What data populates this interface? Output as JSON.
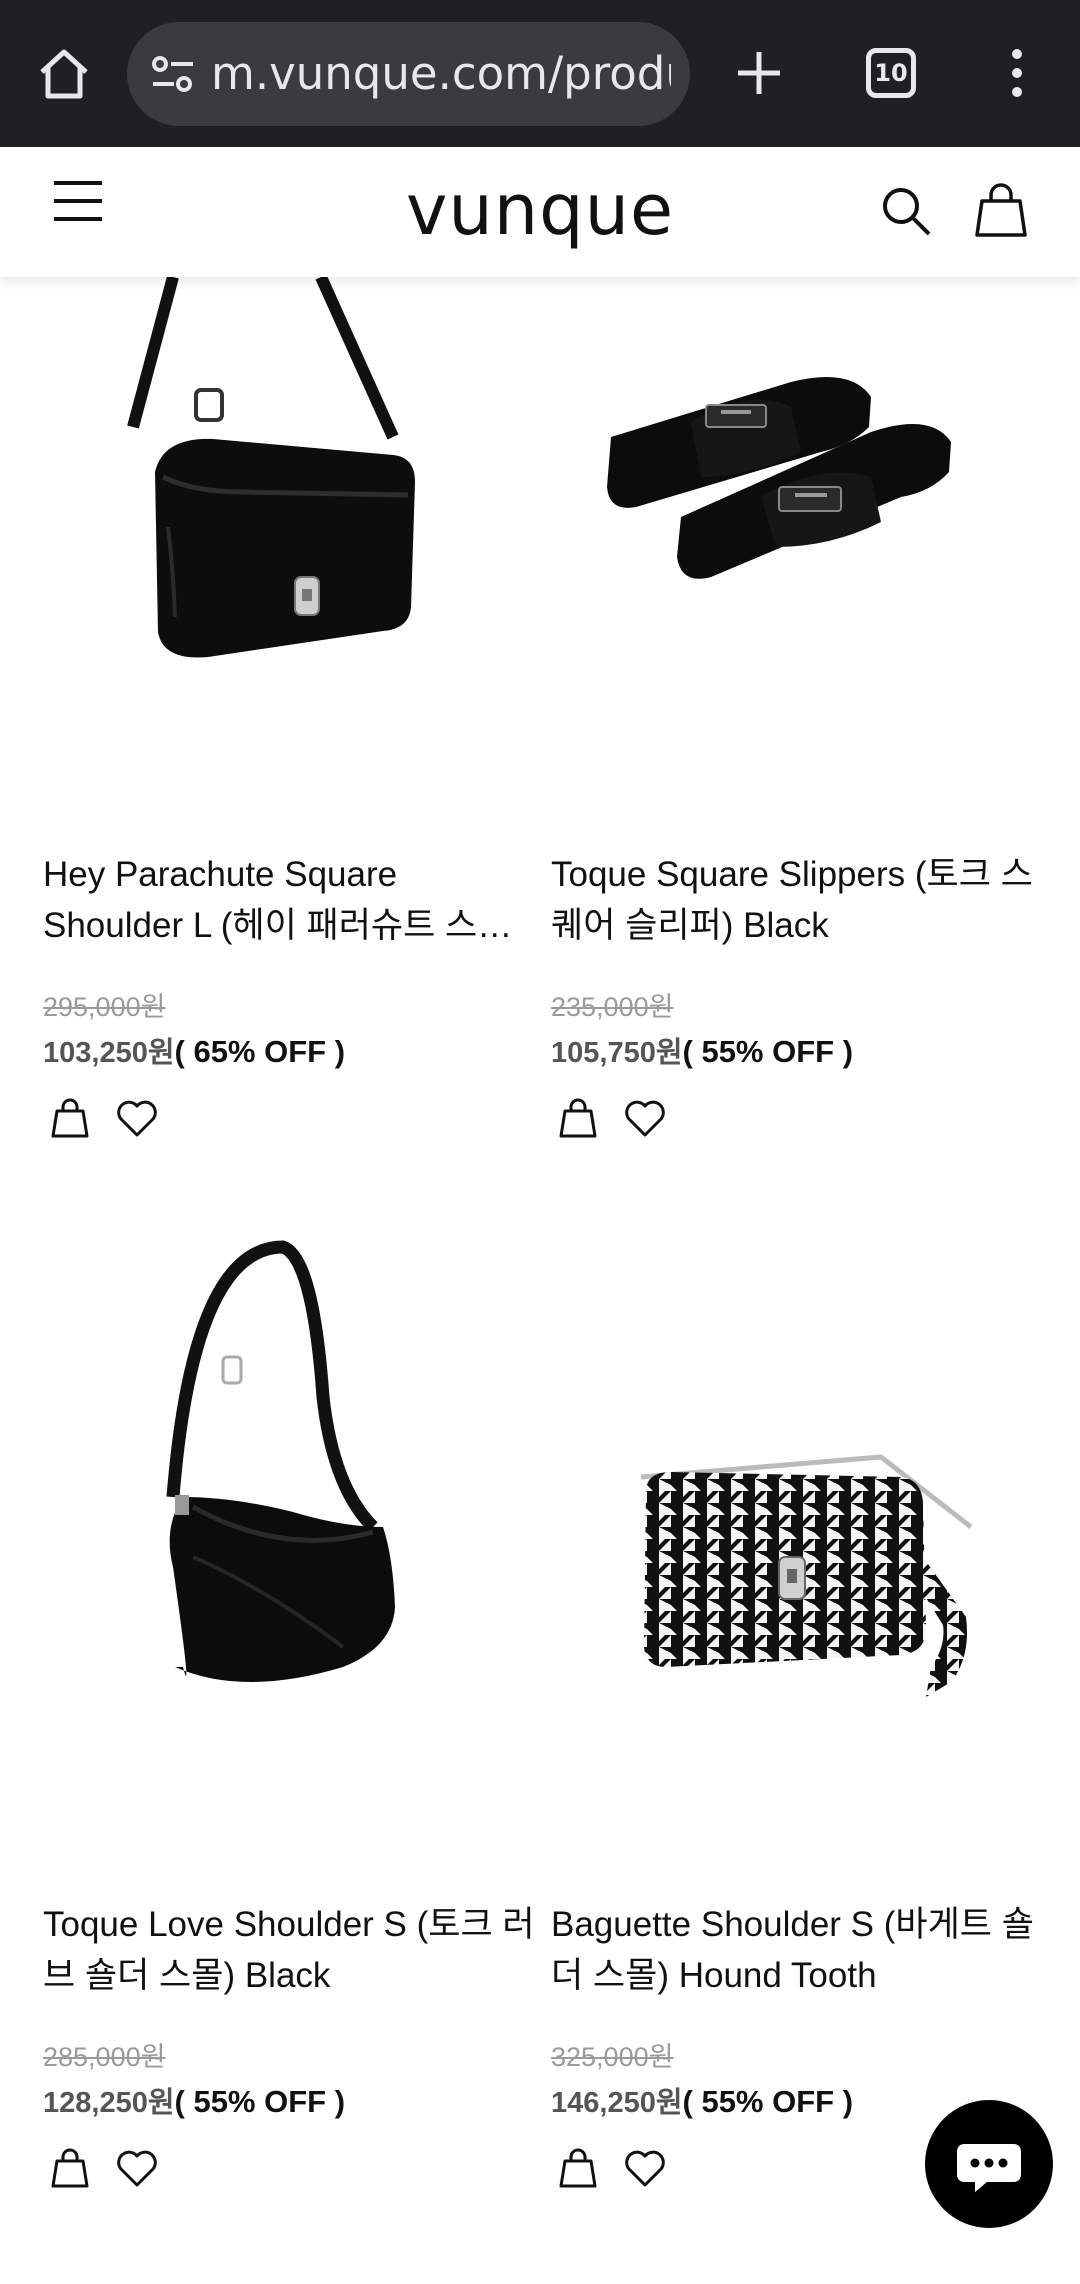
{
  "browser": {
    "url": "m.vunque.com/produ",
    "tab_count": "10"
  },
  "site": {
    "logo": "vunque"
  },
  "products": [
    {
      "name": "Hey Parachute Square Shoulder L (헤이 패러슈트 스퀘어 숄더 라지) Black",
      "original_price": "295,000원",
      "sale_price": "103,250원",
      "discount": "( 65% OFF )"
    },
    {
      "name": "Toque Square Slippers (토크 스퀘어 슬리퍼) Black",
      "original_price": "235,000원",
      "sale_price": "105,750원",
      "discount": "( 55% OFF )"
    },
    {
      "name": "Toque Love Shoulder S (토크 러브 숄더 스몰) Black",
      "original_price": "285,000원",
      "sale_price": "128,250원",
      "discount": "( 55% OFF )"
    },
    {
      "name": "Baguette Shoulder S (바게트 숄더 스몰) Hound Tooth",
      "original_price": "325,000원",
      "sale_price": "146,250원",
      "discount": "( 55% OFF )"
    }
  ],
  "icons": {
    "home": "home-icon",
    "tune": "site-settings-icon",
    "new_tab": "plus-icon",
    "menu": "more-vert-icon",
    "hamburger": "hamburger-icon",
    "search": "search-icon",
    "cart": "shopping-bag-icon",
    "wishlist": "heart-icon",
    "chat": "chat-bubble-icon"
  },
  "colors": {
    "browser_bar": "#1f2023",
    "accent": "#000000",
    "strike_price": "#9a9a9a"
  }
}
